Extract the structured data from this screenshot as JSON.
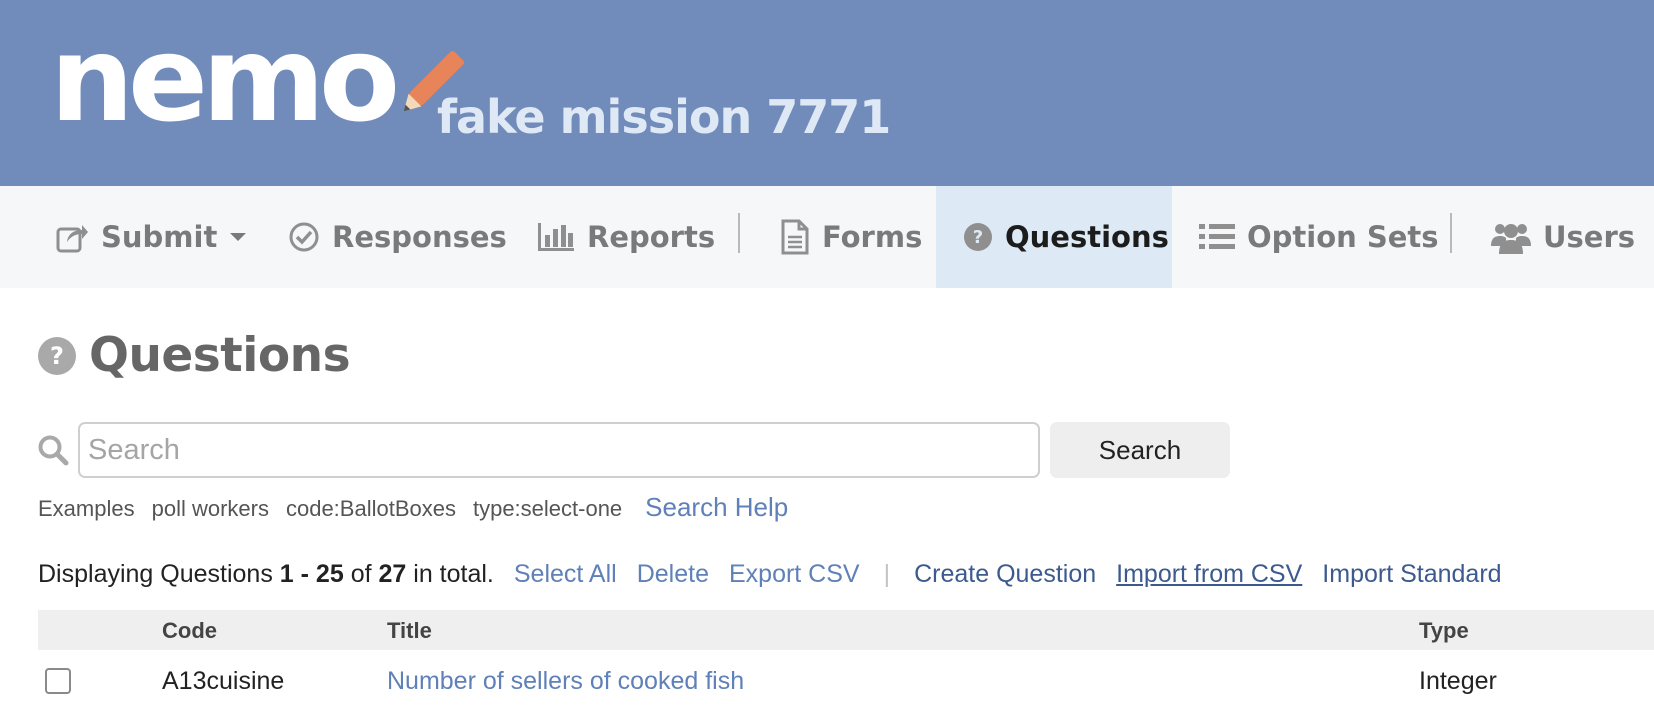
{
  "header": {
    "logo_text": "nemo",
    "mission_name": "fake mission 7771"
  },
  "nav": {
    "items": [
      {
        "label": "Submit",
        "icon": "share-icon"
      },
      {
        "label": "Responses",
        "icon": "check-circle-icon"
      },
      {
        "label": "Reports",
        "icon": "bar-chart-icon"
      },
      {
        "label": "Forms",
        "icon": "document-icon"
      },
      {
        "label": "Questions",
        "icon": "question-circle-icon",
        "active": true
      },
      {
        "label": "Option Sets",
        "icon": "list-icon"
      },
      {
        "label": "Users",
        "icon": "users-icon"
      }
    ]
  },
  "page": {
    "title": "Questions"
  },
  "search": {
    "placeholder": "Search",
    "value": "",
    "button_label": "Search",
    "examples_label": "Examples",
    "examples": [
      "poll workers",
      "code:BallotBoxes",
      "type:select-one"
    ],
    "help_label": "Search Help"
  },
  "listing": {
    "prefix": "Displaying Questions",
    "range": "1 - 25",
    "of": "of",
    "total": "27",
    "suffix": "in total.",
    "actions": {
      "select_all": "Select All",
      "delete": "Delete",
      "export_csv": "Export CSV",
      "create_question": "Create Question",
      "import_csv": "Import from CSV",
      "import_standard": "Import Standard"
    }
  },
  "table": {
    "columns": {
      "code": "Code",
      "title": "Title",
      "type": "Type"
    },
    "rows": [
      {
        "code": "A13cuisine",
        "title": "Number of sellers of cooked fish",
        "type": "Integer"
      }
    ]
  },
  "colors": {
    "banner": "#718bbb",
    "nav_active": "#dde9f5",
    "link": "#5f80b8",
    "pencil": "#e8845a"
  }
}
